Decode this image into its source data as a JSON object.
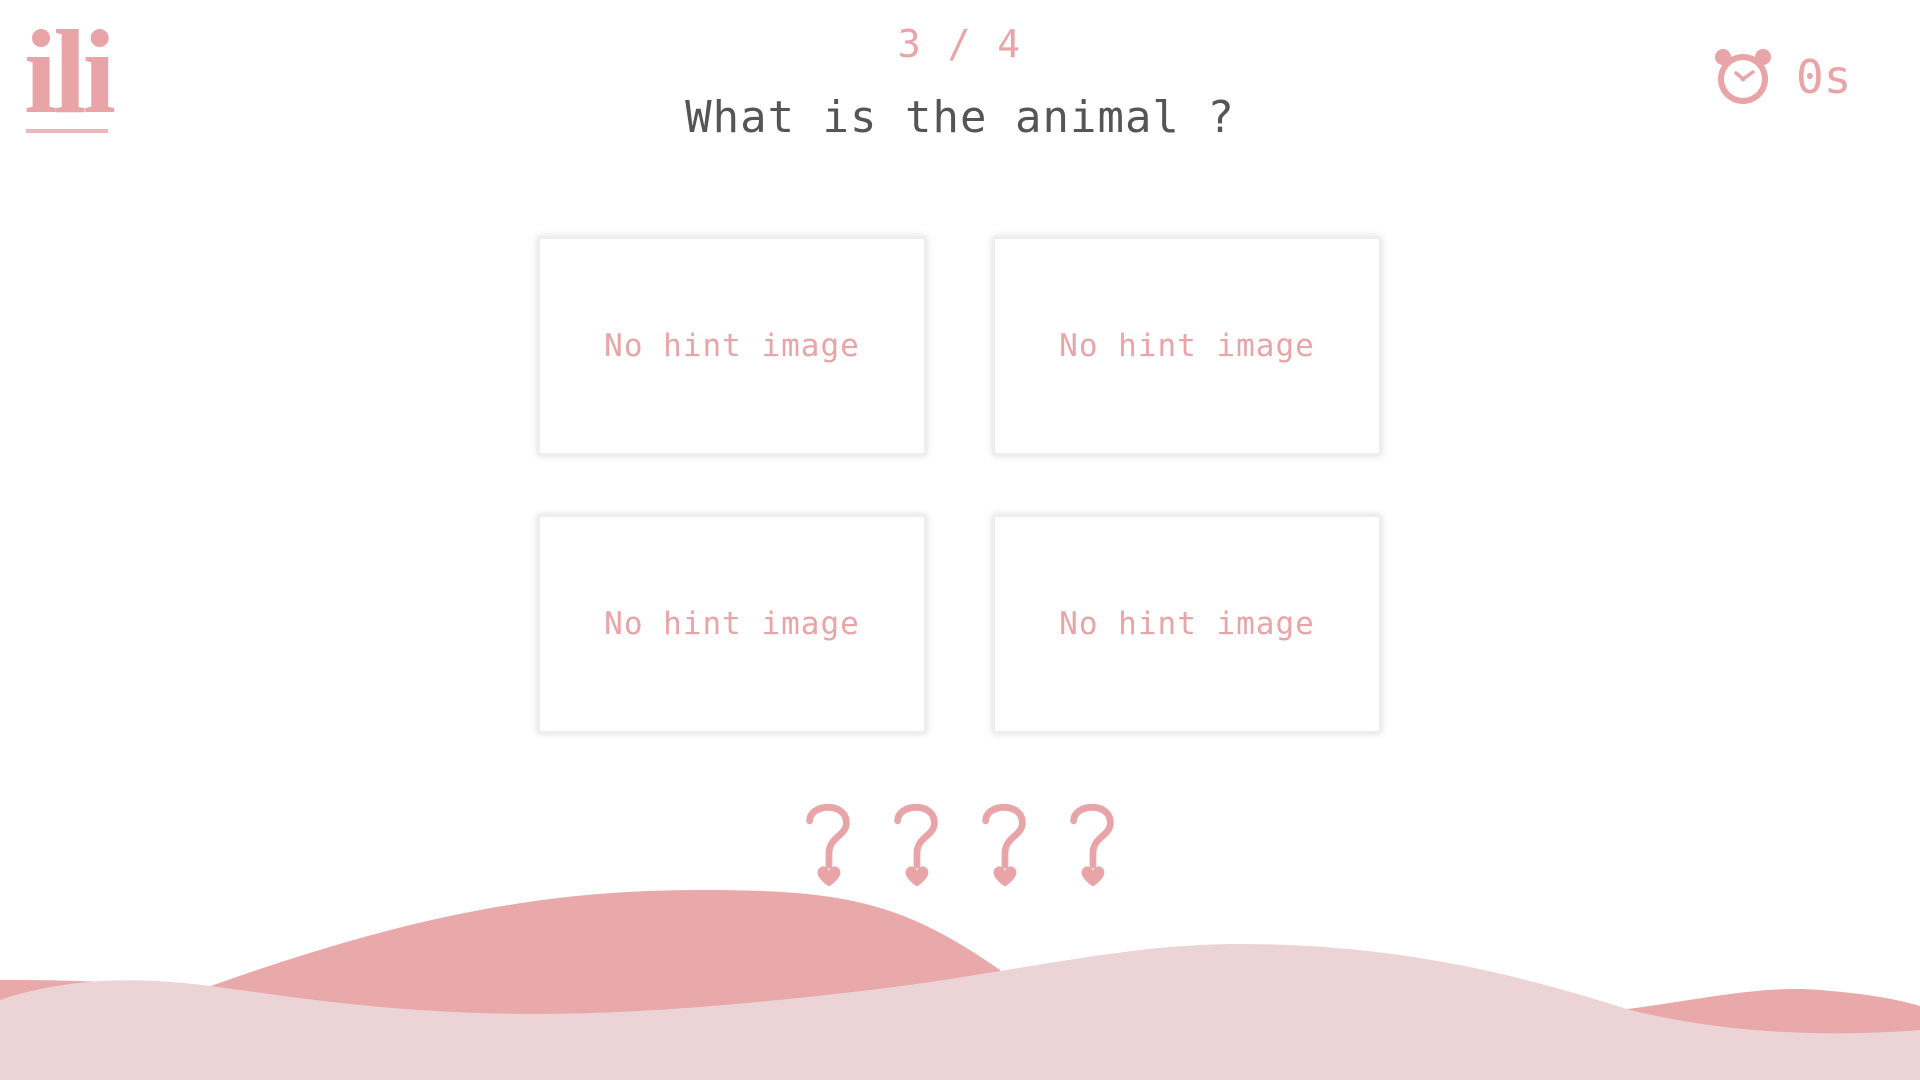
{
  "logo": {
    "text": "ili"
  },
  "header": {
    "progress": "3 / 4",
    "question": "What is the animal ?"
  },
  "timer": {
    "icon": "alarm-clock-icon",
    "value": "0s"
  },
  "options": [
    {
      "label": "No hint image"
    },
    {
      "label": "No hint image"
    },
    {
      "label": "No hint image"
    },
    {
      "label": "No hint image"
    }
  ],
  "answer": {
    "slot_icon": "question-heart-icon",
    "slots": 4
  },
  "colors": {
    "accent": "#e9a4a8",
    "text": "#555555",
    "hill_light": "#ecd3d5",
    "hill_dark": "#e9a9ab",
    "card_border": "#eeeeee",
    "background": "#ffffff"
  }
}
